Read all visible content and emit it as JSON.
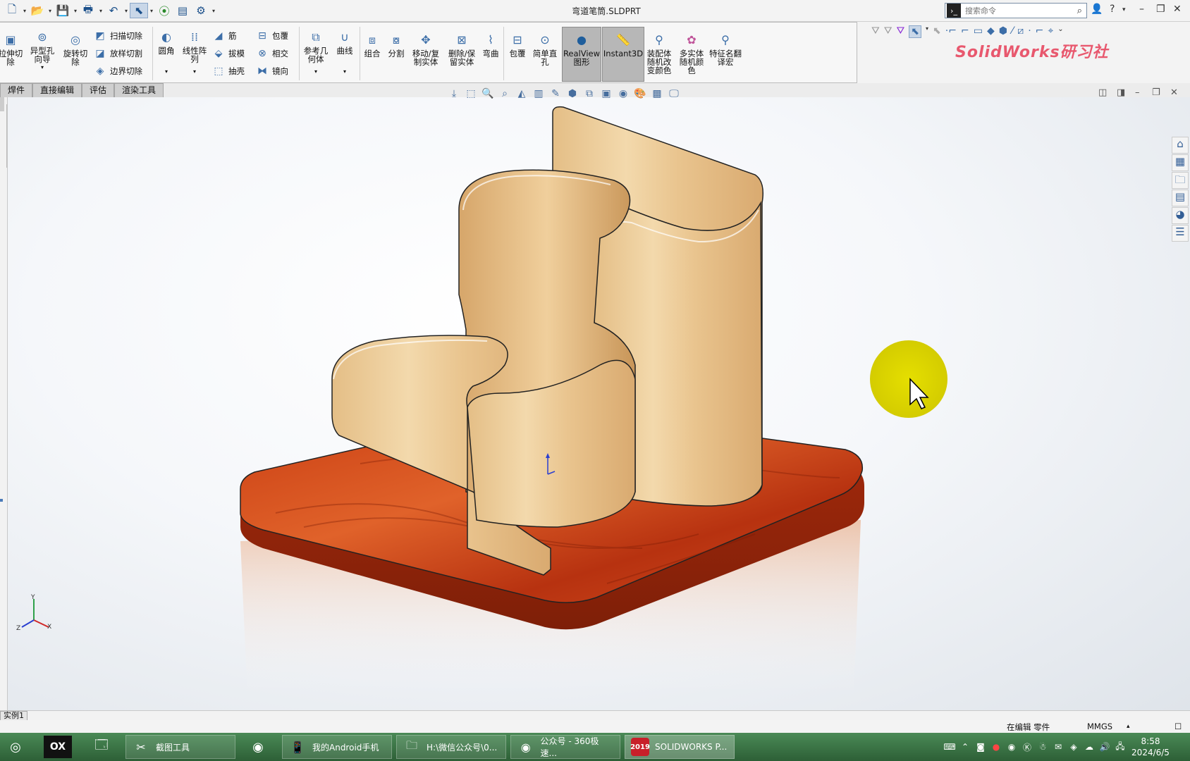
{
  "window": {
    "title": "弯道笔筒.SLDPRT"
  },
  "search": {
    "placeholder": "搜索命令"
  },
  "command_manager": {
    "features": [
      "拉伸切除",
      "异型孔向导",
      "旋转切除",
      "扫描切除",
      "放样切割",
      "边界切除",
      "圆角",
      "线性阵列",
      "筋",
      "拔模",
      "抽壳",
      "包覆",
      "相交",
      "镜向",
      "参考几何体",
      "曲线",
      "组合",
      "分割",
      "移动/复制实体",
      "删除/保留实体",
      "弯曲",
      "包覆",
      "简单直孔",
      "RealView图形",
      "Instant3D",
      "装配体随机改变颜色",
      "多实体随机颜色",
      "特征名翻译宏"
    ]
  },
  "watermark": "SolidWorks研习社",
  "tabs": [
    "焊件",
    "直接编辑",
    "评估",
    "渲染工具"
  ],
  "status": {
    "instance": "实例1",
    "editing": "在编辑 零件",
    "units": "MMGS"
  },
  "axis": {
    "x": "X",
    "y": "Y",
    "z": "Z"
  },
  "taskbar": {
    "items": [
      "截图工具",
      "我的Android手机",
      "H:\\微信公众号\\0...",
      "公众号 - 360极速...",
      "SOLIDWORKS P..."
    ],
    "ox_label": "OX",
    "sw_badge": "2019",
    "clock": {
      "time": "8:58",
      "date": "2024/6/5"
    }
  },
  "colors": {
    "accent": "#3c6ea8",
    "base_wood": "#c4401a",
    "panel_wood": "#e9c891",
    "cursor_halo": "#d9d600"
  }
}
